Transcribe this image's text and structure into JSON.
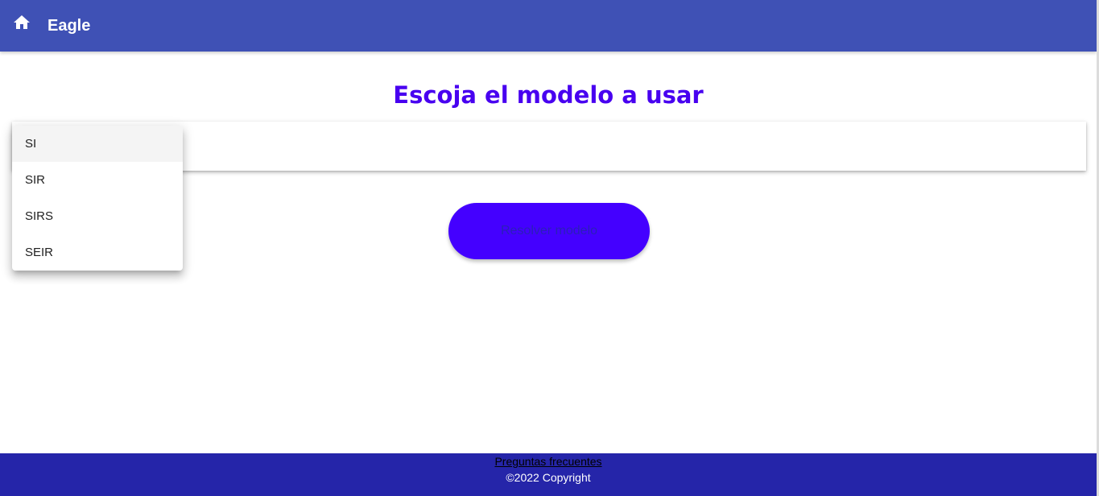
{
  "topbar": {
    "icon": "home-icon",
    "brand": "Eagle",
    "color": "#3f51b5"
  },
  "main": {
    "title": "Escoja el modelo a usar",
    "title_color": "#4800f0",
    "model_select": {
      "selected_value": "",
      "options": [
        "SI",
        "SIR",
        "SIRS",
        "SEIR"
      ],
      "highlighted_option": "SI"
    },
    "solve_button": {
      "label": "Resolver modelo",
      "color": "#4400ff"
    }
  },
  "footer": {
    "faq_link": "Preguntas frecuentes",
    "copyright": "©2022 Copyright",
    "color": "#2525a9"
  }
}
